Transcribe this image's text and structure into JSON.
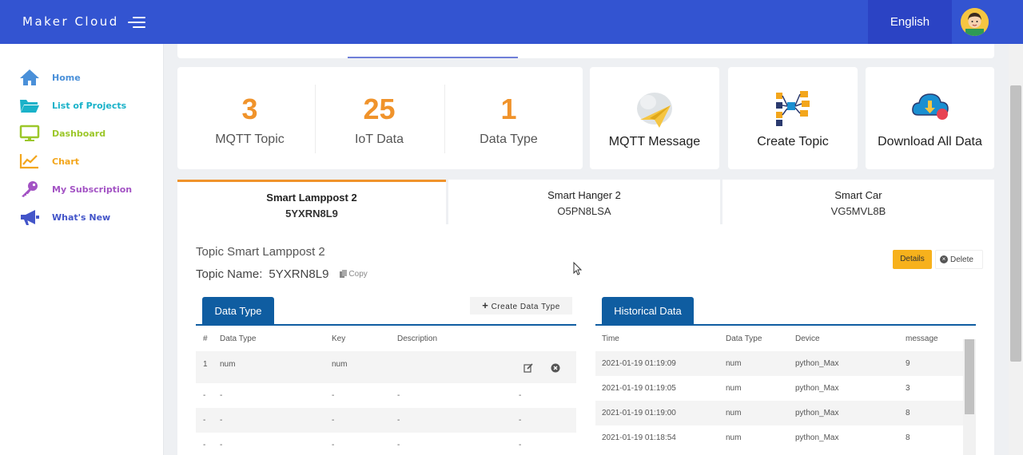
{
  "header": {
    "brand": "Maker Cloud",
    "language": "English"
  },
  "sidebar": {
    "items": [
      {
        "label": "Home",
        "color": "#4a90d9",
        "icon": "home-icon"
      },
      {
        "label": "List of Projects",
        "color": "#1ab2c9",
        "icon": "folder-icon"
      },
      {
        "label": "Dashboard",
        "color": "#9cc72a",
        "icon": "monitor-icon"
      },
      {
        "label": "Chart",
        "color": "#f3a61c",
        "icon": "chart-icon"
      },
      {
        "label": "My Subscription",
        "color": "#a353c4",
        "icon": "key-icon"
      },
      {
        "label": "What's New",
        "color": "#4355c9",
        "icon": "megaphone-icon"
      }
    ]
  },
  "stats": [
    {
      "value": "3",
      "label": "MQTT Topic"
    },
    {
      "value": "25",
      "label": "IoT Data"
    },
    {
      "value": "1",
      "label": "Data Type"
    }
  ],
  "actions": [
    {
      "label": "MQTT Message",
      "icon": "paper-plane-cloud-icon"
    },
    {
      "label": "Create Topic",
      "icon": "network-flow-icon"
    },
    {
      "label": "Download All Data",
      "icon": "cloud-download-icon"
    }
  ],
  "devices": [
    {
      "name": "Smart Lamppost 2",
      "code": "5YXRN8L9"
    },
    {
      "name": "Smart Hanger 2",
      "code": "O5PN8LSA"
    },
    {
      "name": "Smart Car",
      "code": "VG5MVL8B"
    }
  ],
  "topic": {
    "title": "Topic Smart Lamppost 2",
    "name_label": "Topic Name:",
    "name_value": "5YXRN8L9",
    "copy_label": "Copy",
    "details_label": "Details",
    "delete_label": "Delete"
  },
  "data_type_panel": {
    "tab_label": "Data Type",
    "create_label": "Create Data Type",
    "columns": [
      "#",
      "Data Type",
      "Key",
      "Description"
    ],
    "rows": [
      [
        "1",
        "num",
        "num",
        "",
        ""
      ],
      [
        "-",
        "-",
        "-",
        "-",
        "-"
      ],
      [
        "-",
        "-",
        "-",
        "-",
        "-"
      ],
      [
        "-",
        "-",
        "-",
        "-",
        "-"
      ]
    ]
  },
  "history_panel": {
    "tab_label": "Historical Data",
    "columns": [
      "Time",
      "Data Type",
      "Device",
      "message"
    ],
    "rows": [
      [
        "2021-01-19 01:19:09",
        "num",
        "python_Max",
        "9"
      ],
      [
        "2021-01-19 01:19:05",
        "num",
        "python_Max",
        "3"
      ],
      [
        "2021-01-19 01:19:00",
        "num",
        "python_Max",
        "8"
      ],
      [
        "2021-01-19 01:18:54",
        "num",
        "python_Max",
        "8"
      ]
    ]
  },
  "colors": {
    "header": "#3354d1",
    "accent": "#f0932b",
    "tab": "#0f5da1",
    "details": "#f7b11c"
  }
}
